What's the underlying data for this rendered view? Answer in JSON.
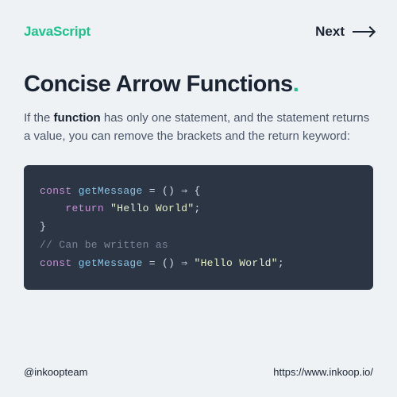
{
  "header": {
    "brand": "JavaScript",
    "next": "Next"
  },
  "title": "Concise Arrow Functions",
  "description": {
    "pre": "If the ",
    "bold": "function",
    "post": " has only one statement, and the statement returns a value, you can remove the brackets and the return keyword:"
  },
  "code": {
    "l1": {
      "kw": "const",
      "fn": "getMessage",
      "eq": " = () ⇒  {"
    },
    "l2": {
      "kw": "return",
      "str": "\"Hello World\"",
      "semi": ";"
    },
    "l3": "}",
    "l4": " ",
    "l5": "// Can be written as",
    "l6": {
      "kw": "const",
      "fn": "getMessage",
      "eq": " = () ⇒ ",
      "str": "\"Hello World\"",
      "semi": ";"
    }
  },
  "footer": {
    "handle": "@inkoopteam",
    "url": "https://www.inkoop.io/"
  }
}
